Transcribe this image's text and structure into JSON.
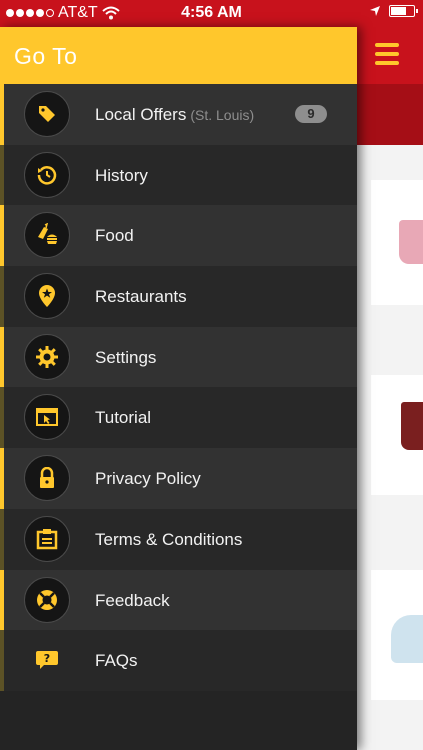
{
  "status_bar": {
    "carrier": "AT&T",
    "time": "4:56 AM",
    "signal_dots_filled": 4,
    "signal_dots_total": 5,
    "battery_level": 0.6
  },
  "drawer": {
    "title": "Go To",
    "items": [
      {
        "id": "local-offers",
        "label": "Local Offers",
        "sublabel": "(St. Louis)",
        "badge": "9",
        "icon": "tag-icon"
      },
      {
        "id": "history",
        "label": "History",
        "icon": "history-icon"
      },
      {
        "id": "food",
        "label": "Food",
        "icon": "food-icon"
      },
      {
        "id": "restaurants",
        "label": "Restaurants",
        "icon": "location-pin-icon"
      },
      {
        "id": "settings",
        "label": "Settings",
        "icon": "gear-icon"
      },
      {
        "id": "tutorial",
        "label": "Tutorial",
        "icon": "tutorial-icon"
      },
      {
        "id": "privacy-policy",
        "label": "Privacy Policy",
        "icon": "lock-icon"
      },
      {
        "id": "terms",
        "label": "Terms & Conditions",
        "icon": "clipboard-icon"
      },
      {
        "id": "feedback",
        "label": "Feedback",
        "icon": "lifebuoy-icon"
      },
      {
        "id": "faqs",
        "label": "FAQs",
        "icon": "question-bubble-icon"
      }
    ]
  },
  "colors": {
    "brand_red": "#c8121c",
    "brand_yellow": "#ffc72c",
    "drawer_bg": "#242424"
  }
}
